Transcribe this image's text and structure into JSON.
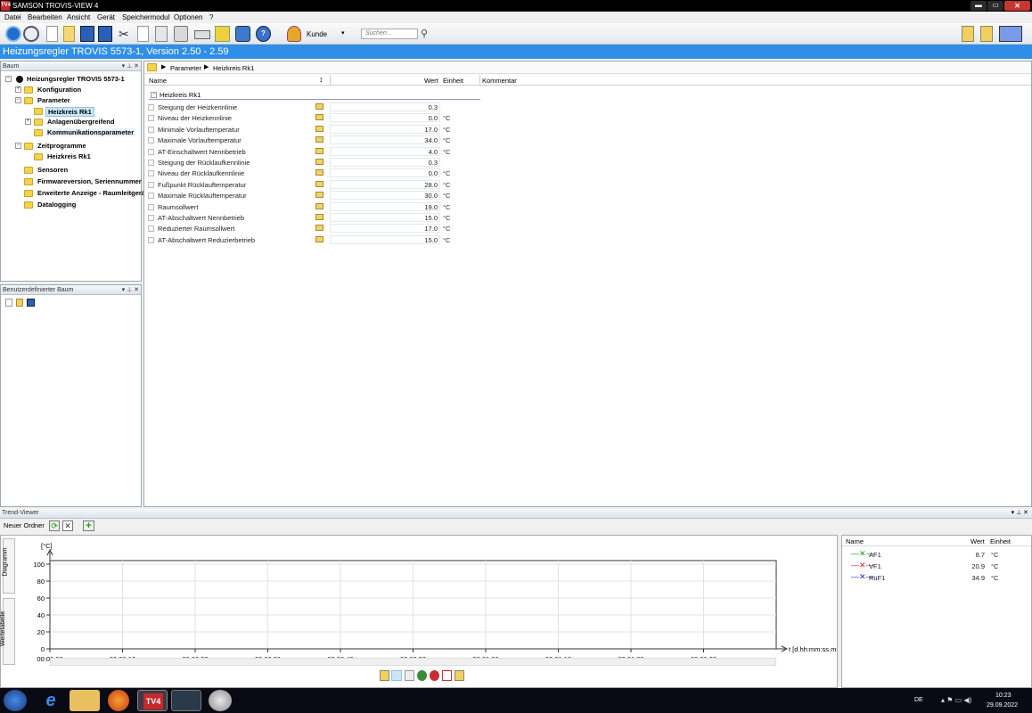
{
  "window": {
    "title": "SAMSON TROVIS-VIEW 4",
    "logo": "TV4"
  },
  "menu": [
    "Datei",
    "Bearbeiten",
    "Ansicht",
    "Gerät",
    "Speichermodul",
    "Optionen",
    "?"
  ],
  "toolbar": {
    "user_label": "Kunde",
    "search_placeholder": "Suchen..."
  },
  "banner": {
    "title": "Heizungsregler TROVIS 5573-1, Version 2.50 - 2.59"
  },
  "tree_panel": {
    "title": "Baum",
    "items": [
      {
        "label": "Heizungsregler TROVIS 5573-1",
        "level": 0,
        "icon": "device-icon"
      },
      {
        "label": "Konfiguration",
        "level": 1,
        "icon": "folder-icon"
      },
      {
        "label": "Parameter",
        "level": 1,
        "icon": "folder-icon"
      },
      {
        "label": "Heizkreis Rk1",
        "level": 2,
        "icon": "folder-icon",
        "selected": true
      },
      {
        "label": "Anlagenübergreifend",
        "level": 2,
        "icon": "folder-icon"
      },
      {
        "label": "Kommunikationsparameter",
        "level": 2,
        "icon": "folder-icon"
      },
      {
        "label": "Zeitprogramme",
        "level": 1,
        "icon": "folder-icon"
      },
      {
        "label": "Heizkreis Rk1",
        "level": 2,
        "icon": "folder-icon"
      },
      {
        "label": "Sensoren",
        "level": 1,
        "icon": "folder-icon"
      },
      {
        "label": "Firmwareversion, Seriennummer",
        "level": 1,
        "icon": "folder-icon"
      },
      {
        "label": "Erweiterte Anzeige - Raumleitgerä",
        "level": 1,
        "icon": "folder-icon"
      },
      {
        "label": "Datalogging",
        "level": 1,
        "icon": "folder-icon"
      }
    ]
  },
  "custom_tree_panel": {
    "title": "Benutzerdefinierter Baum"
  },
  "breadcrumb": [
    "Parameter",
    "Heizkreis Rk1"
  ],
  "param_table": {
    "columns": {
      "name": "Name",
      "value": "Wert",
      "unit": "Einheit",
      "comment": "Kommentar"
    },
    "group": "Heizkreis Rk1",
    "rows": [
      {
        "name": "Steigung der Heizkennlinie",
        "value": "0.3",
        "unit": ""
      },
      {
        "name": "Niveau der Heizkennlinie",
        "value": "0.0",
        "unit": "°C"
      },
      {
        "name": "Minimale Vorlauftemperatur",
        "value": "17.0",
        "unit": "°C"
      },
      {
        "name": "Maximale Vorlauftemperatur",
        "value": "34.0",
        "unit": "°C"
      },
      {
        "name": "AT-Einschaltwert Nennbetrieb",
        "value": "4.0",
        "unit": "°C"
      },
      {
        "name": "Steigung der Rücklaufkennlinie",
        "value": "0.3",
        "unit": ""
      },
      {
        "name": "Niveau der Rücklaufkennlinie",
        "value": "0.0",
        "unit": "°C"
      },
      {
        "name": "Fußpunkt Rücklauftemperatur",
        "value": "28.0",
        "unit": "°C"
      },
      {
        "name": "Maximale Rücklauftemperatur",
        "value": "30.0",
        "unit": "°C"
      },
      {
        "name": "Raumsollwert",
        "value": "19.0",
        "unit": "°C"
      },
      {
        "name": "AT-Abschaltwert Nennbetrieb",
        "value": "15.0",
        "unit": "°C"
      },
      {
        "name": "Reduzierter Raumsollwert",
        "value": "17.0",
        "unit": "°C"
      },
      {
        "name": "AT-Abschaltwert Reduzierbetrieb",
        "value": "15.0",
        "unit": "°C"
      }
    ]
  },
  "trend": {
    "title": "Trend-Viewer",
    "folder_tab": "Neuer Ordner",
    "side_tabs": [
      "Diagramm",
      "Wertetabelle"
    ],
    "chart": {
      "y_unit": "[°C]",
      "y_ticks": [
        "100",
        "80",
        "60",
        "40",
        "20",
        "0"
      ],
      "x_ticks": [
        "00:00:00",
        "00:00:10",
        "00:00:20",
        "00:00:30",
        "00:00:40",
        "00:00:50",
        "00:01:00",
        "00:01:10",
        "00:01:20",
        "00:01:30"
      ],
      "x_label": "t [d.hh:mm:ss.ms]"
    },
    "legend": {
      "columns": {
        "name": "Name",
        "value": "Wert",
        "unit": "Einheit"
      },
      "rows": [
        {
          "name": "AF1",
          "value": "8.7",
          "unit": "°C",
          "color": "#1a9a1a"
        },
        {
          "name": "VF1",
          "value": "20.9",
          "unit": "°C",
          "color": "#e02020"
        },
        {
          "name": "RüF1",
          "value": "34.9",
          "unit": "°C",
          "color": "#1c2ae0"
        }
      ]
    }
  },
  "taskbar": {
    "lang": "DE",
    "time": "10:23",
    "date": "29.09.2022",
    "tv_label": "TV4"
  }
}
